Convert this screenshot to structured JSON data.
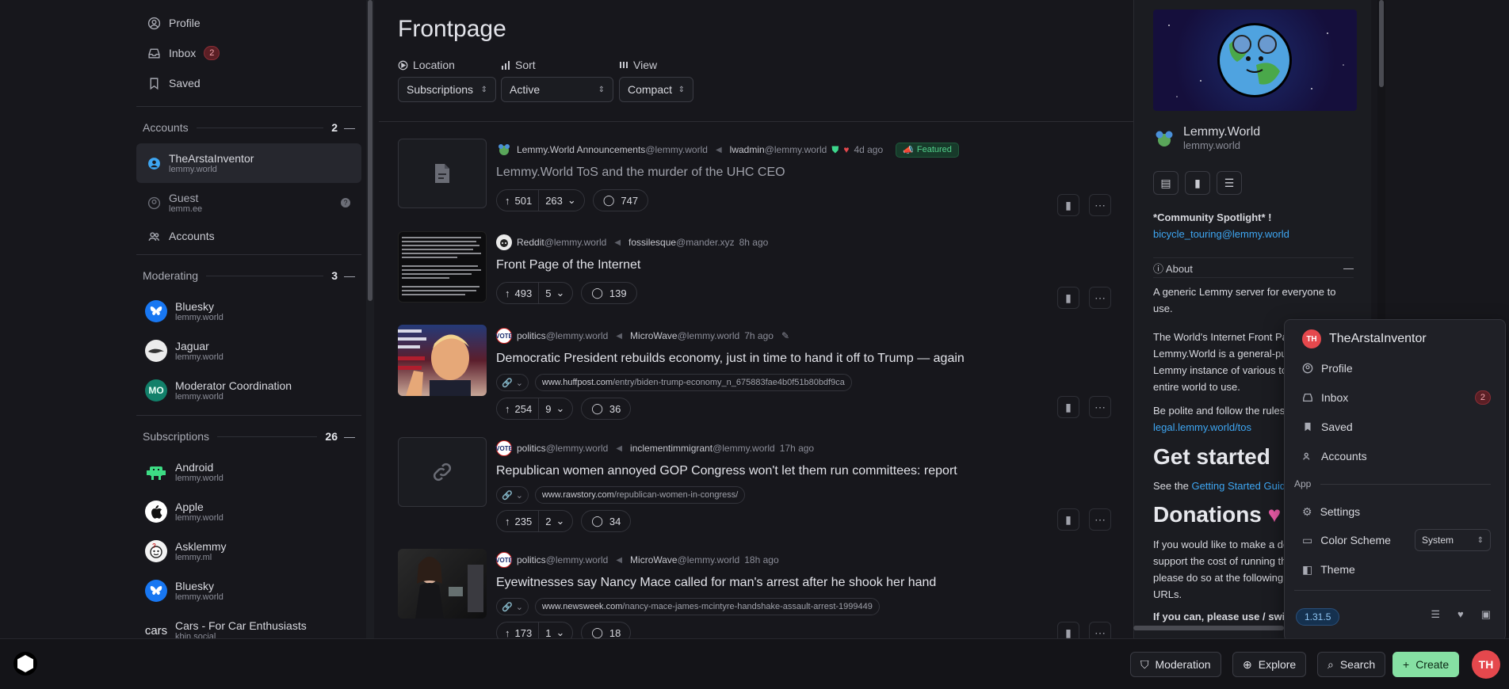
{
  "sidebar": {
    "links": [
      {
        "label": "Profile",
        "icon": "user-circle-icon"
      },
      {
        "label": "Inbox",
        "badge": "2",
        "icon": "inbox-icon"
      },
      {
        "label": "Saved",
        "icon": "bookmark-icon"
      }
    ],
    "accounts": {
      "title": "Accounts",
      "count": "2",
      "items": [
        {
          "name": "TheArstaInventor",
          "instance": "lemmy.world"
        },
        {
          "name": "Guest",
          "instance": "lemm.ee"
        }
      ],
      "manage_label": "Accounts"
    },
    "moderating": {
      "title": "Moderating",
      "count": "3",
      "items": [
        {
          "name": "Bluesky",
          "instance": "lemmy.world"
        },
        {
          "name": "Jaguar",
          "instance": "lemmy.world"
        },
        {
          "name": "Moderator Coordination",
          "instance": "lemmy.world",
          "initials": "MO"
        }
      ]
    },
    "subscriptions": {
      "title": "Subscriptions",
      "count": "26",
      "items": [
        {
          "name": "Android",
          "instance": "lemmy.world"
        },
        {
          "name": "Apple",
          "instance": "lemmy.world"
        },
        {
          "name": "Asklemmy",
          "instance": "lemmy.ml"
        },
        {
          "name": "Bluesky",
          "instance": "lemmy.world"
        },
        {
          "name": "Cars - For Car Enthusiasts",
          "instance": "kbin.social",
          "initials": "cars"
        }
      ]
    }
  },
  "main": {
    "title": "Frontpage",
    "filters": {
      "location": {
        "label": "Location",
        "value": "Subscriptions"
      },
      "sort": {
        "label": "Sort",
        "value": "Active"
      },
      "view": {
        "label": "View",
        "value": "Compact"
      }
    },
    "posts": [
      {
        "community": "Lemmy.World Announcements",
        "community_instance": "@lemmy.world",
        "author": "lwadmin",
        "author_instance": "@lemmy.world",
        "time": "4d ago",
        "featured": "Featured",
        "title": "Lemmy.World ToS and the murder of the UHC CEO",
        "upvotes": "501",
        "downvotes": "263",
        "comments": "747"
      },
      {
        "community": "Reddit",
        "community_instance": "@lemmy.world",
        "author": "fossilesque",
        "author_instance": "@mander.xyz",
        "time": "8h ago",
        "title": "Front Page of the Internet",
        "upvotes": "493",
        "downvotes": "5",
        "comments": "139"
      },
      {
        "community": "politics",
        "community_instance": "@lemmy.world",
        "author": "MicroWave",
        "author_instance": "@lemmy.world",
        "time": "7h ago",
        "title": "Democratic President rebuilds economy, just in time to hand it off to Trump — again",
        "url_domain": "www.huffpost.com",
        "url_path": "/entry/biden-trump-economy_n_675883fae4b0f51b80bdf9ca",
        "upvotes": "254",
        "downvotes": "9",
        "comments": "36"
      },
      {
        "community": "politics",
        "community_instance": "@lemmy.world",
        "author": "inclementimmigrant",
        "author_instance": "@lemmy.world",
        "time": "17h ago",
        "title": "Republican women annoyed GOP Congress won't let them run committees: report",
        "url_domain": "www.rawstory.com",
        "url_path": "/republican-women-in-congress/",
        "upvotes": "235",
        "downvotes": "2",
        "comments": "34"
      },
      {
        "community": "politics",
        "community_instance": "@lemmy.world",
        "author": "MicroWave",
        "author_instance": "@lemmy.world",
        "time": "18h ago",
        "title": "Eyewitnesses say Nancy Mace called for man's arrest after he shook her hand",
        "url_domain": "www.newsweek.com",
        "url_path": "/nancy-mace-james-mcintyre-handshake-assault-arrest-1999449",
        "upvotes": "173",
        "downvotes": "1",
        "comments": "18"
      }
    ]
  },
  "right": {
    "site_name": "Lemmy.World",
    "site_instance": "lemmy.world",
    "spotlight": "Community Spotlight",
    "spotlight_link": "bicycle_touring@lemmy.world",
    "about_label": "About",
    "about_1": "A generic Lemmy server for everyone to use.",
    "about_2": "The World's Internet Front Page Lemmy.World is a general-purpose Lemmy instance of various topics, for the entire world to use.",
    "rules": "Be polite and follow the rules",
    "rules_link": "legal.lemmy.world/tos",
    "get_started": "Get started",
    "see_the": "See the",
    "guide_link": "Getting Started Guide",
    "donations": "Donations",
    "donate_text": "If you would like to make a donation to support the cost of running this platform, please do so at the following donation URLs.",
    "if_you_can": "If you can, please use / switch to"
  },
  "user_menu": {
    "initials": "TH",
    "name": "TheArstaInventor",
    "items": [
      "Profile",
      "Inbox",
      "Saved",
      "Accounts"
    ],
    "inbox_badge": "2",
    "app_label": "App",
    "settings": "Settings",
    "color_scheme": "Color Scheme",
    "color_scheme_value": "System",
    "theme": "Theme",
    "version": "1.31.5"
  },
  "bottom_bar": {
    "moderation": "Moderation",
    "explore": "Explore",
    "search": "Search",
    "create": "Create",
    "avatar_initials": "TH"
  },
  "colors": {
    "accent": "#3ea6f2",
    "create": "#86e0a3",
    "avatar": "#e5484d",
    "featured": "#52d18b"
  }
}
